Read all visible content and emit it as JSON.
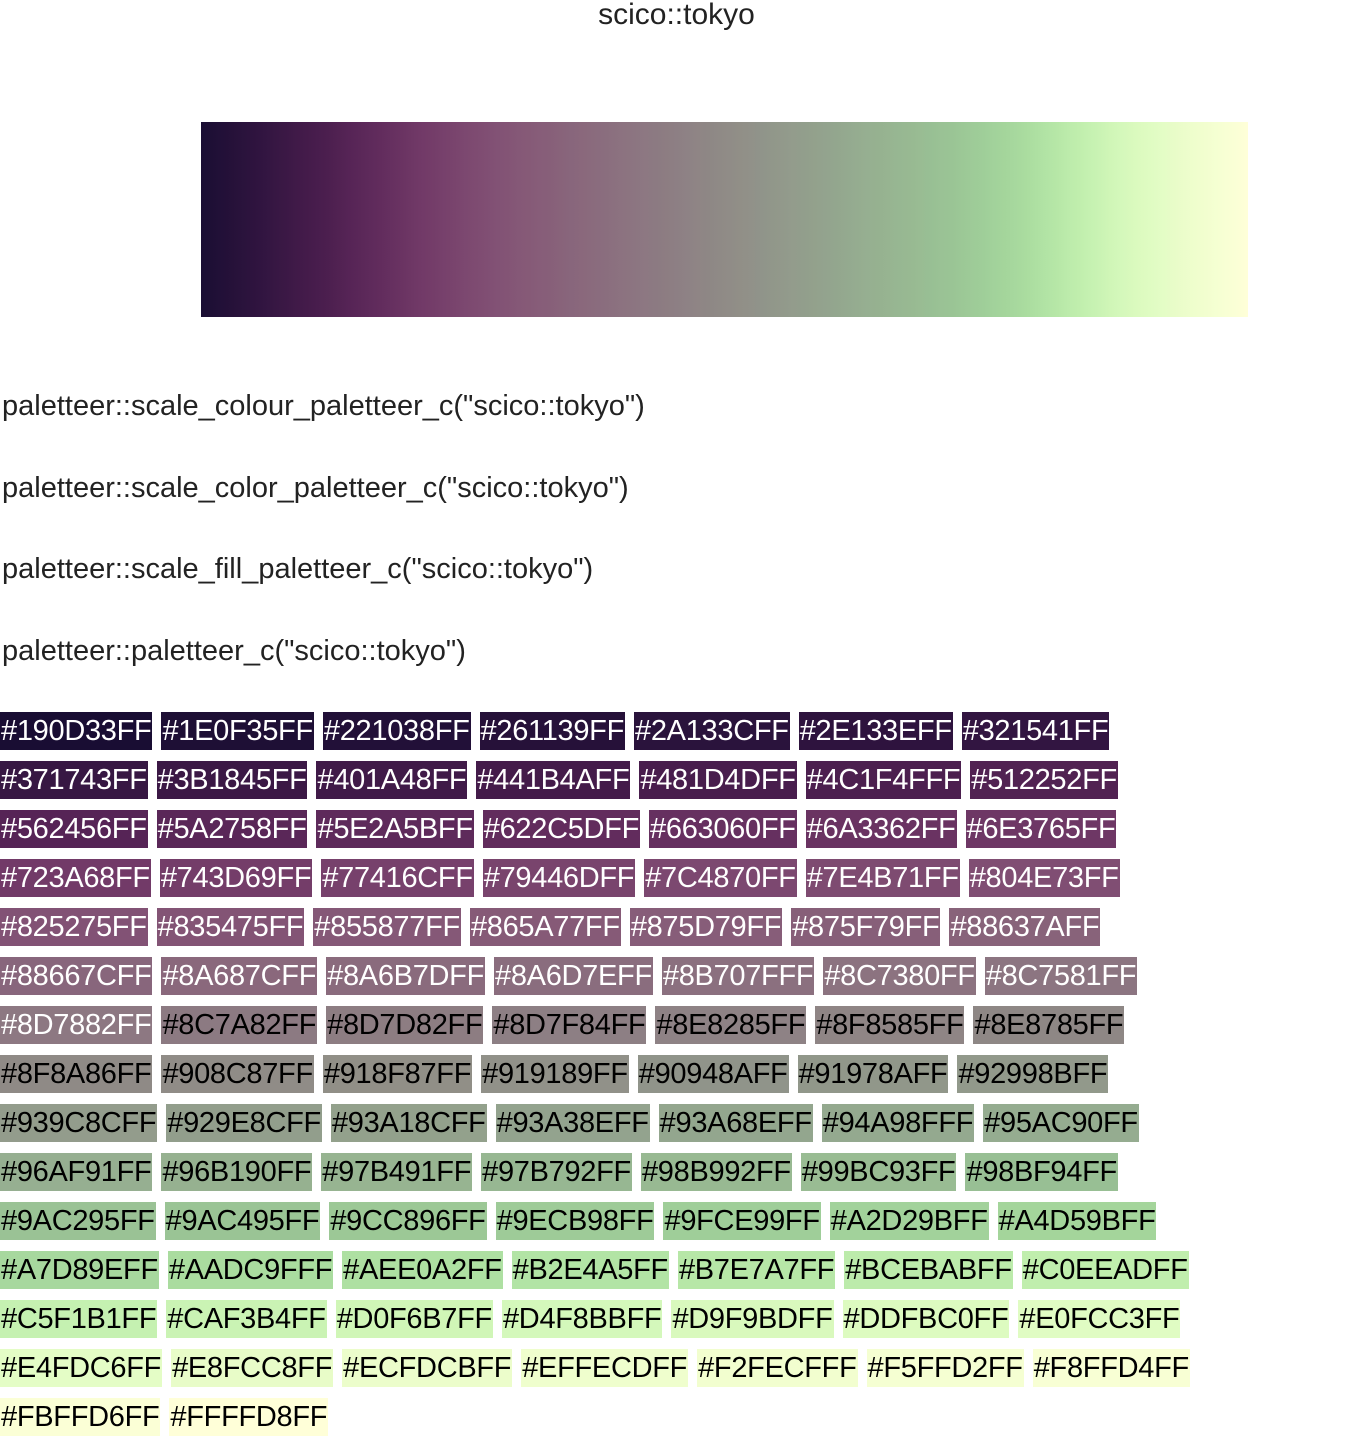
{
  "title": "scico::tokyo",
  "snippets": [
    "paletteer::scale_colour_paletteer_c(\"scico::tokyo\")",
    "paletteer::scale_color_paletteer_c(\"scico::tokyo\")",
    "paletteer::scale_fill_paletteer_c(\"scico::tokyo\")",
    "paletteer::paletteer_c(\"scico::tokyo\")"
  ],
  "colors": [
    "#190D33FF",
    "#1E0F35FF",
    "#221038FF",
    "#261139FF",
    "#2A133CFF",
    "#2E133EFF",
    "#321541FF",
    "#371743FF",
    "#3B1845FF",
    "#401A48FF",
    "#441B4AFF",
    "#481D4DFF",
    "#4C1F4FFF",
    "#512252FF",
    "#562456FF",
    "#5A2758FF",
    "#5E2A5BFF",
    "#622C5DFF",
    "#663060FF",
    "#6A3362FF",
    "#6E3765FF",
    "#723A68FF",
    "#743D69FF",
    "#77416CFF",
    "#79446DFF",
    "#7C4870FF",
    "#7E4B71FF",
    "#804E73FF",
    "#825275FF",
    "#835475FF",
    "#855877FF",
    "#865A77FF",
    "#875D79FF",
    "#875F79FF",
    "#88637AFF",
    "#88667CFF",
    "#8A687CFF",
    "#8A6B7DFF",
    "#8A6D7EFF",
    "#8B707FFF",
    "#8C7380FF",
    "#8C7581FF",
    "#8D7882FF",
    "#8C7A82FF",
    "#8D7D82FF",
    "#8D7F84FF",
    "#8E8285FF",
    "#8F8585FF",
    "#8E8785FF",
    "#8F8A86FF",
    "#908C87FF",
    "#918F87FF",
    "#919189FF",
    "#90948AFF",
    "#91978AFF",
    "#92998BFF",
    "#939C8CFF",
    "#929E8CFF",
    "#93A18CFF",
    "#93A38EFF",
    "#93A68EFF",
    "#94A98FFF",
    "#95AC90FF",
    "#96AF91FF",
    "#96B190FF",
    "#97B491FF",
    "#97B792FF",
    "#98B992FF",
    "#99BC93FF",
    "#98BF94FF",
    "#9AC295FF",
    "#9AC495FF",
    "#9CC896FF",
    "#9ECB98FF",
    "#9FCE99FF",
    "#A2D29BFF",
    "#A4D59BFF",
    "#A7D89EFF",
    "#AADC9FFF",
    "#AEE0A2FF",
    "#B2E4A5FF",
    "#B7E7A7FF",
    "#BCEBABFF",
    "#C0EEADFF",
    "#C5F1B1FF",
    "#CAF3B4FF",
    "#D0F6B7FF",
    "#D4F8BBFF",
    "#D9F9BDFF",
    "#DDFBC0FF",
    "#E0FCC3FF",
    "#E4FDC6FF",
    "#E8FCC8FF",
    "#ECFDCBFF",
    "#EFFECDFF",
    "#F2FECFFF",
    "#F5FFD2FF",
    "#F8FFD4FF",
    "#FBFFD6FF",
    "#FFFFD8FF"
  ]
}
